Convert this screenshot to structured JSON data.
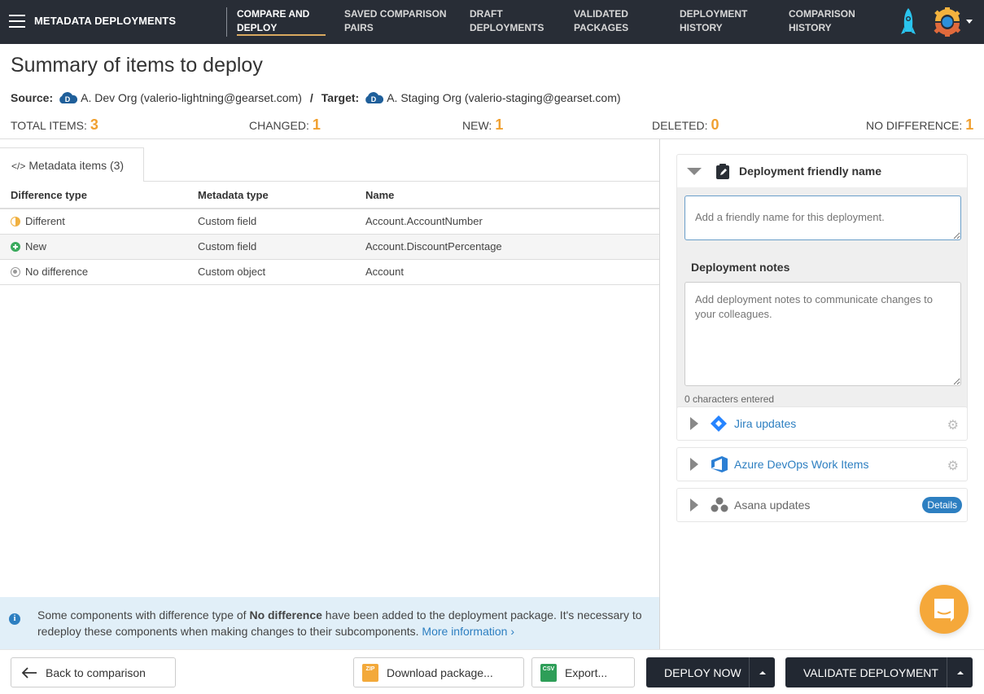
{
  "topbar": {
    "app_title": "METADATA DEPLOYMENTS",
    "nav": [
      {
        "line1": "COMPARE AND",
        "line2": "DEPLOY",
        "active": true
      },
      {
        "line1": "SAVED COMPARISON",
        "line2": "PAIRS"
      },
      {
        "line1": "DRAFT",
        "line2": "DEPLOYMENTS"
      },
      {
        "line1": "VALIDATED",
        "line2": "PACKAGES"
      },
      {
        "line1": "DEPLOYMENT",
        "line2": "HISTORY"
      },
      {
        "line1": "COMPARISON",
        "line2": "HISTORY"
      }
    ],
    "icons": {
      "menu": "hamburger-icon",
      "rocket": "rocket-icon",
      "account": "gearset-logo-icon"
    }
  },
  "summary": {
    "title": "Summary of items to deploy",
    "source_label": "Source:",
    "source_badge": "D",
    "source_org": "A. Dev Org (valerio-lightning@gearset.com)",
    "separator": "/",
    "target_label": "Target:",
    "target_badge": "D",
    "target_org": "A. Staging Org (valerio-staging@gearset.com)",
    "stats": [
      {
        "label": "TOTAL ITEMS:",
        "value": "3"
      },
      {
        "label": "CHANGED:",
        "value": "1"
      },
      {
        "label": "NEW:",
        "value": "1"
      },
      {
        "label": "DELETED:",
        "value": "0"
      },
      {
        "label": "NO DIFFERENCE:",
        "value": "1"
      }
    ],
    "accent_color": "#f0a030"
  },
  "metadata": {
    "tab_label": "Metadata items (3)",
    "columns": [
      "Difference type",
      "Metadata type",
      "Name"
    ],
    "rows": [
      {
        "difference": "Different",
        "type": "Custom field",
        "name": "Account.AccountNumber"
      },
      {
        "difference": "New",
        "type": "Custom field",
        "name": "Account.DiscountPercentage"
      },
      {
        "difference": "No difference",
        "type": "Custom object",
        "name": "Account"
      }
    ]
  },
  "info": {
    "text_before": "Some components with difference type of ",
    "bold": "No difference",
    "text_after": " have been added to the deployment package. It's necessary to redeploy these components when making changes to their subcomponents. ",
    "link": "More information ›"
  },
  "right": {
    "friendly_title": "Deployment friendly name",
    "friendly_placeholder": "Add a friendly name for this deployment.",
    "notes_label": "Deployment notes",
    "notes_placeholder": "Add deployment notes to communicate changes to your colleagues.",
    "chars_entered": "0 characters entered",
    "integrations": [
      {
        "label": "Jira updates",
        "action": "gear"
      },
      {
        "label": "Azure DevOps Work Items",
        "action": "gear"
      },
      {
        "label": "Asana updates",
        "action": "Details"
      }
    ]
  },
  "footer": {
    "back": "Back to comparison",
    "download": "Download package...",
    "export": "Export...",
    "deploy": "DEPLOY NOW",
    "validate": "VALIDATE DEPLOYMENT",
    "zip_label": "ZIP",
    "csv_label": "CSV"
  }
}
